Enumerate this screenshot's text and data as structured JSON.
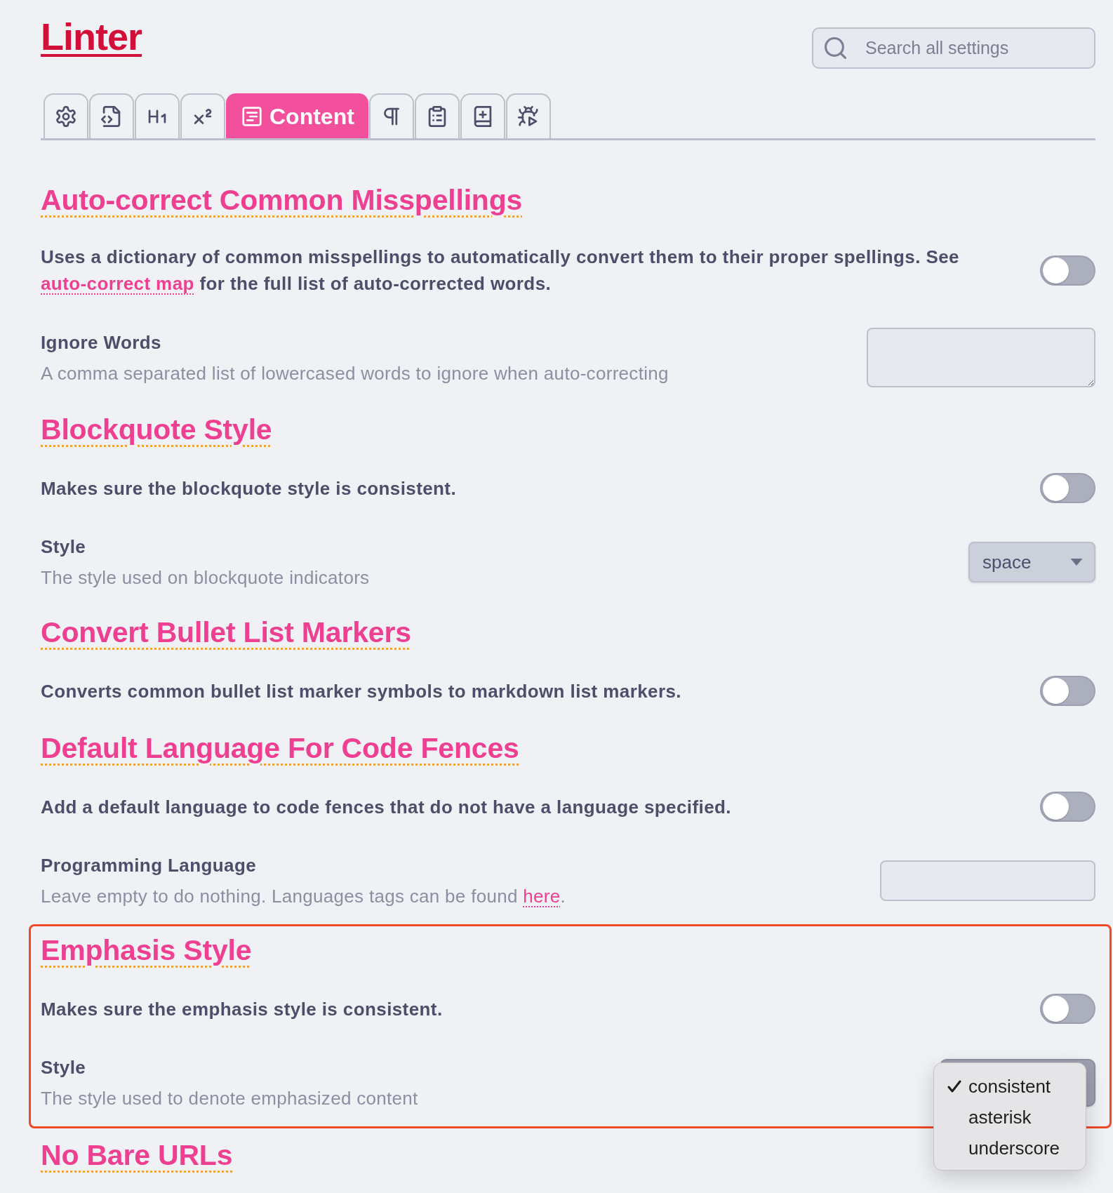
{
  "title": "Linter",
  "search": {
    "placeholder": "Search all settings"
  },
  "tabs": [
    {
      "selected": false
    },
    {
      "selected": false
    },
    {
      "selected": false
    },
    {
      "selected": false
    },
    {
      "label": "Content",
      "selected": true
    },
    {
      "selected": false
    },
    {
      "selected": false
    },
    {
      "selected": false
    },
    {
      "selected": false
    }
  ],
  "sections": [
    {
      "heading": "Auto-correct Common Misspellings",
      "highlighted": false,
      "settings": [
        {
          "kind": "toggle",
          "name": [
            {
              "kind": "text",
              "text": "Uses a dictionary of common misspellings to automatically convert them to their proper spellings. See "
            },
            {
              "kind": "link",
              "text": "auto-correct map"
            },
            {
              "kind": "text",
              "text": " for the full list of auto-corrected words."
            }
          ],
          "on": false
        },
        {
          "kind": "textarea",
          "name": [
            {
              "kind": "text",
              "text": "Ignore Words"
            }
          ],
          "description": [
            {
              "kind": "text",
              "text": "A comma separated list of lowercased words to ignore when auto-correcting"
            }
          ]
        }
      ]
    },
    {
      "heading": "Blockquote Style",
      "highlighted": false,
      "settings": [
        {
          "kind": "toggle",
          "name": [
            {
              "kind": "text",
              "text": "Makes sure the blockquote style is consistent."
            }
          ],
          "on": false
        },
        {
          "kind": "select",
          "name": [
            {
              "kind": "text",
              "text": "Style"
            }
          ],
          "description": [
            {
              "kind": "text",
              "text": "The style used on blockquote indicators"
            }
          ],
          "value": "space",
          "open": false
        }
      ]
    },
    {
      "heading": "Convert Bullet List Markers",
      "highlighted": false,
      "settings": [
        {
          "kind": "toggle",
          "name": [
            {
              "kind": "text",
              "text": "Converts common bullet list marker symbols to markdown list markers."
            }
          ],
          "on": false
        }
      ]
    },
    {
      "heading": "Default Language For Code Fences",
      "highlighted": false,
      "settings": [
        {
          "kind": "toggle",
          "name": [
            {
              "kind": "text",
              "text": "Add a default language to code fences that do not have a language specified."
            }
          ],
          "on": false
        },
        {
          "kind": "input",
          "name": [
            {
              "kind": "text",
              "text": "Programming Language"
            }
          ],
          "description": [
            {
              "kind": "text",
              "text": "Leave empty to do nothing. Languages tags can be found "
            },
            {
              "kind": "link",
              "text": "here"
            },
            {
              "kind": "text",
              "text": "."
            }
          ]
        }
      ]
    },
    {
      "heading": "Emphasis Style",
      "highlighted": true,
      "settings": [
        {
          "kind": "toggle",
          "name": [
            {
              "kind": "text",
              "text": "Makes sure the emphasis style is consistent."
            }
          ],
          "on": false
        },
        {
          "kind": "select",
          "name": [
            {
              "kind": "text",
              "text": "Style"
            }
          ],
          "description": [
            {
              "kind": "text",
              "text": "The style used to denote emphasized content"
            }
          ],
          "open": true,
          "options": [
            {
              "label": "consistent",
              "selected": true
            },
            {
              "label": "asterisk",
              "selected": false
            },
            {
              "label": "underscore",
              "selected": false
            }
          ]
        }
      ]
    },
    {
      "heading": "No Bare URLs",
      "highlighted": false
    }
  ]
}
